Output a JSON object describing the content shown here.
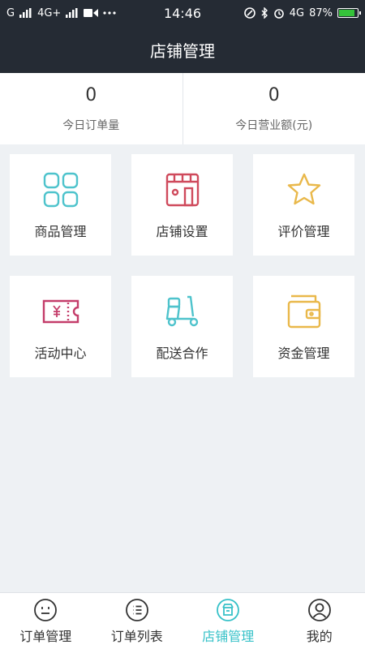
{
  "status_bar": {
    "carrier": "G",
    "network_left": "4G+",
    "time": "14:46",
    "network_right": "4G",
    "battery": "87%",
    "icons": [
      "signal-icon",
      "video-icon",
      "more-icon",
      "nfc-icon",
      "bluetooth-icon",
      "alarm-icon",
      "battery-icon"
    ],
    "colors": {
      "bar": "#252b34",
      "battery_fill": "#35c23a"
    }
  },
  "header": {
    "title": "店铺管理"
  },
  "stats": [
    {
      "value": "0",
      "label": "今日订单量"
    },
    {
      "value": "0",
      "label": "今日营业额(元)"
    }
  ],
  "menu": [
    {
      "label": "商品管理",
      "icon": "goods-grid-icon",
      "color": "#4ec3cc"
    },
    {
      "label": "店铺设置",
      "icon": "store-icon",
      "color": "#cf4a5c"
    },
    {
      "label": "评价管理",
      "icon": "star-icon",
      "color": "#e9b84a"
    },
    {
      "label": "活动中心",
      "icon": "coupon-icon",
      "color": "#c43d6a"
    },
    {
      "label": "配送合作",
      "icon": "delivery-scooter-icon",
      "color": "#4ec3cc"
    },
    {
      "label": "资金管理",
      "icon": "wallet-icon",
      "color": "#e9b84a"
    }
  ],
  "tabs": [
    {
      "label": "订单管理",
      "icon": "order-face-icon",
      "active": false
    },
    {
      "label": "订单列表",
      "icon": "list-icon",
      "active": false
    },
    {
      "label": "店铺管理",
      "icon": "shop-icon",
      "active": true
    },
    {
      "label": "我的",
      "icon": "profile-icon",
      "active": false
    }
  ],
  "accent": "#36c1c8"
}
